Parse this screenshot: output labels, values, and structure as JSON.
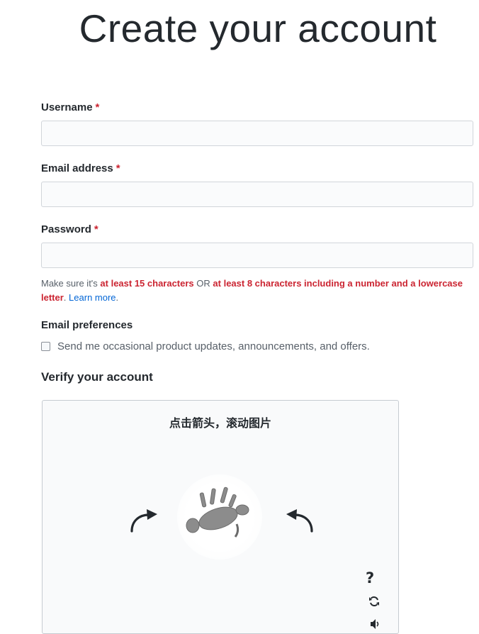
{
  "title": "Create your account",
  "fields": {
    "username": {
      "label": "Username",
      "required_mark": "*",
      "value": "",
      "placeholder": ""
    },
    "email": {
      "label": "Email address",
      "required_mark": "*",
      "value": "",
      "placeholder": ""
    },
    "password": {
      "label": "Password",
      "required_mark": "*",
      "value": "",
      "placeholder": ""
    }
  },
  "password_hint": {
    "prefix": "Make sure it's ",
    "rule1": "at least 15 characters",
    "middle": " OR ",
    "rule2": "at least 8 characters including a number and a lowercase letter",
    "dot": ".",
    "link": "Learn more",
    "end": "."
  },
  "email_preferences": {
    "title": "Email preferences",
    "checkbox_label": "Send me occasional product updates, announcements, and offers.",
    "checked": false
  },
  "verify": {
    "title": "Verify your account",
    "instruction": "点击箭头，滚动图片",
    "help_icon": "?",
    "refresh_icon": "refresh-icon",
    "audio_icon": "audio-icon"
  },
  "colors": {
    "required": "#cb2431",
    "link": "#0366d6",
    "text": "#24292e",
    "muted": "#586069"
  }
}
